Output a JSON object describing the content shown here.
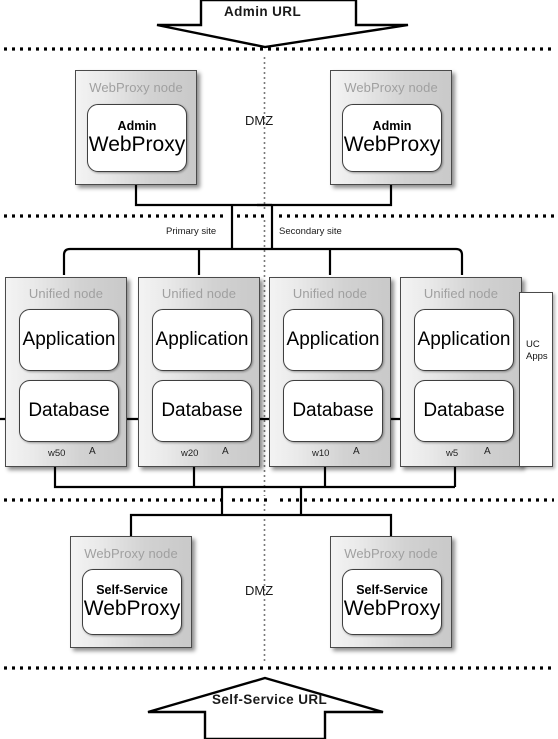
{
  "diagram": {
    "title": "Admin URL",
    "zones": {
      "dmz_top_label": "DMZ",
      "dmz_bottom_label": "DMZ",
      "primary_site_label": "Primary site",
      "secondary_site_label": "Secondary site"
    },
    "top_arrow": {
      "label": "Admin  URL",
      "direction": "down"
    },
    "bottom_arrow": {
      "label": "Self-Service URL",
      "direction": "up"
    },
    "webproxy_nodes_top": [
      {
        "node_title": "WebProxy node",
        "role": "Admin",
        "component": "WebProxy"
      },
      {
        "node_title": "WebProxy node",
        "role": "Admin",
        "component": "WebProxy"
      }
    ],
    "webproxy_nodes_bottom": [
      {
        "node_title": "WebProxy node",
        "role": "Self-Service",
        "component": "WebProxy"
      },
      {
        "node_title": "WebProxy node",
        "role": "Self-Service",
        "component": "WebProxy"
      }
    ],
    "unified_nodes": [
      {
        "node_title": "Unified node",
        "application": "Application",
        "database": "Database",
        "weight": "w50",
        "flag": "A",
        "site": "Primary site"
      },
      {
        "node_title": "Unified node",
        "application": "Application",
        "database": "Database",
        "weight": "w20",
        "flag": "A",
        "site": "Primary site"
      },
      {
        "node_title": "Unified node",
        "application": "Application",
        "database": "Database",
        "weight": "w10",
        "flag": "A",
        "site": "Secondary site"
      },
      {
        "node_title": "Unified node",
        "application": "Application",
        "database": "Database",
        "weight": "w5",
        "flag": "A",
        "site": "Secondary site"
      }
    ],
    "uc_apps_box": {
      "line1": "UC",
      "line2": "Apps"
    },
    "colors": {
      "node_fill_light": "#f3f3f3",
      "node_fill_dark": "#c9c9c9",
      "node_border": "#4a4a4a",
      "node_title_text": "#a0a0a0",
      "inner_fill": "#ffffff",
      "line": "#000000",
      "background": "#ffffff"
    }
  }
}
